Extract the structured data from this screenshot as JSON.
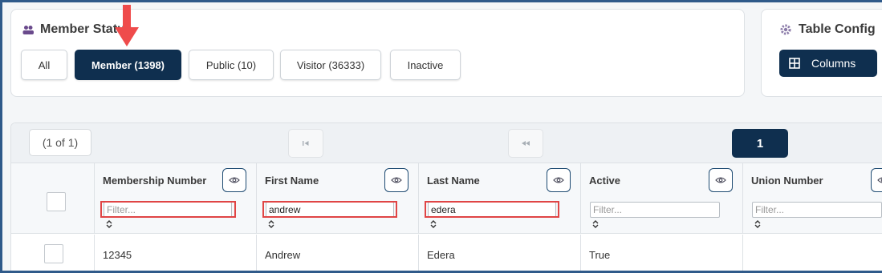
{
  "member_status": {
    "title": "Member Status",
    "icon": "users-icon",
    "filters": [
      {
        "label": "All",
        "active": false
      },
      {
        "label": "Member (1398)",
        "active": true
      },
      {
        "label": "Public (10)",
        "active": false
      },
      {
        "label": "Visitor (36333)",
        "active": false
      },
      {
        "label": "Inactive",
        "active": false
      }
    ]
  },
  "table_config": {
    "title": "Table Config",
    "icon": "gear-icon",
    "columns_label": "Columns"
  },
  "pager": {
    "info": "(1 of 1)",
    "current_page": "1"
  },
  "columns": [
    {
      "header": "Membership Number",
      "filter_value": "",
      "filter_placeholder": "Filter..."
    },
    {
      "header": "First Name",
      "filter_value": "andrew",
      "filter_placeholder": "Filter..."
    },
    {
      "header": "Last Name",
      "filter_value": "edera",
      "filter_placeholder": "Filter..."
    },
    {
      "header": "Active",
      "filter_value": "",
      "filter_placeholder": "Filter..."
    },
    {
      "header": "Union Number",
      "filter_value": "",
      "filter_placeholder": "Filter..."
    }
  ],
  "rows": [
    {
      "membership_number": "12345",
      "first_name": "Andrew",
      "last_name": "Edera",
      "active": "True",
      "union_number": ""
    }
  ],
  "colors": {
    "primary": "#0f2f4f",
    "highlight": "#e04545",
    "arrow": "#ef4b4b"
  }
}
